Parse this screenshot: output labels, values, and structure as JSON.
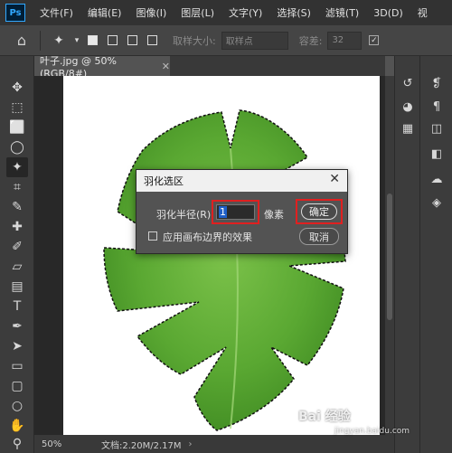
{
  "menubar": {
    "logo": "Ps",
    "items": [
      "文件(F)",
      "编辑(E)",
      "图像(I)",
      "图层(L)",
      "文字(Y)",
      "选择(S)",
      "滤镜(T)",
      "3D(D)",
      "视"
    ]
  },
  "options": {
    "sample_size_label": "取样大小:",
    "sample_size_value": "取样点",
    "tolerance_label": "容差:",
    "tolerance_value": "32"
  },
  "document": {
    "tab_title": "叶子.jpg @ 50%(RGB/8#)",
    "zoom": "50%",
    "doc_info": "文档:2.20M/2.17M"
  },
  "dialog": {
    "title": "羽化选区",
    "radius_label": "羽化半径(R):",
    "radius_value": "1",
    "unit": "像素",
    "ok_label": "确定",
    "cancel_label": "取消",
    "checkbox_label": "应用画布边界的效果"
  },
  "watermark": {
    "main": "Bai 经验",
    "sub": "jingyan.baidu.com"
  },
  "colors": {
    "leaf": "#5aa832",
    "highlight_border": "#e02020",
    "selection": "#1f5fc8"
  }
}
